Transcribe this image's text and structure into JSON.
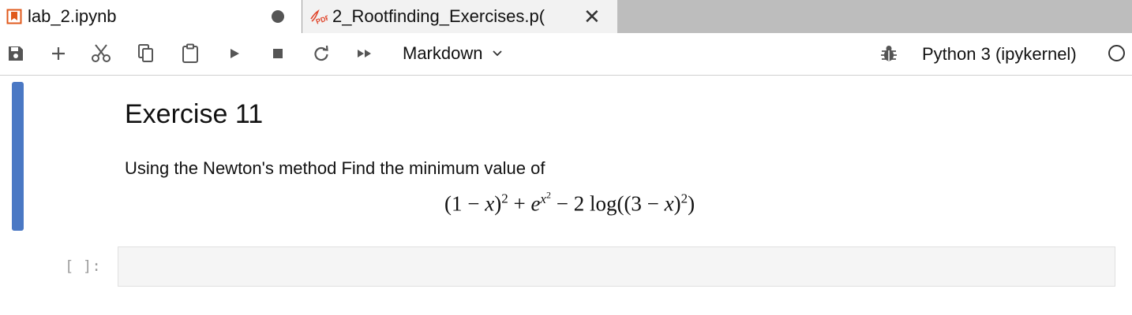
{
  "tabs": [
    {
      "label": "lab_2.ipynb",
      "icon": "notebook-icon",
      "active": true,
      "unsaved": true
    },
    {
      "label": "2_Rootfinding_Exercises.p(",
      "icon": "pdf-icon",
      "active": false
    }
  ],
  "toolbar": {
    "buttons": [
      "save-icon",
      "add-cell-icon",
      "cut-icon",
      "copy-icon",
      "paste-icon",
      "run-icon",
      "stop-icon",
      "restart-icon",
      "run-all-icon"
    ],
    "cell_type": "Markdown",
    "kernel": "Python 3 (ipykernel)",
    "debug_icon": "bug-icon"
  },
  "notebook": {
    "markdown_cell": {
      "heading": "Exercise 11",
      "paragraph": "Using the Newton's method Find the minimum value of",
      "equation": {
        "part1": "(1 − ",
        "var_x": "x",
        "part2": ")",
        "exp2": "2",
        "part3": " + ",
        "e": "e",
        "x_sup": "x",
        "x_sup_exp": "2",
        "part4": " − 2 log((3 − ",
        "var_x2": "x",
        "part5": ")",
        "exp3": "2",
        "part6": ")"
      }
    },
    "code_cell": {
      "prompt": "[ ]:",
      "source": ""
    }
  },
  "colors": {
    "accent": "#4a78c4",
    "tab_background": "#bdbdbd",
    "code_cell_background": "#f5f5f5"
  }
}
